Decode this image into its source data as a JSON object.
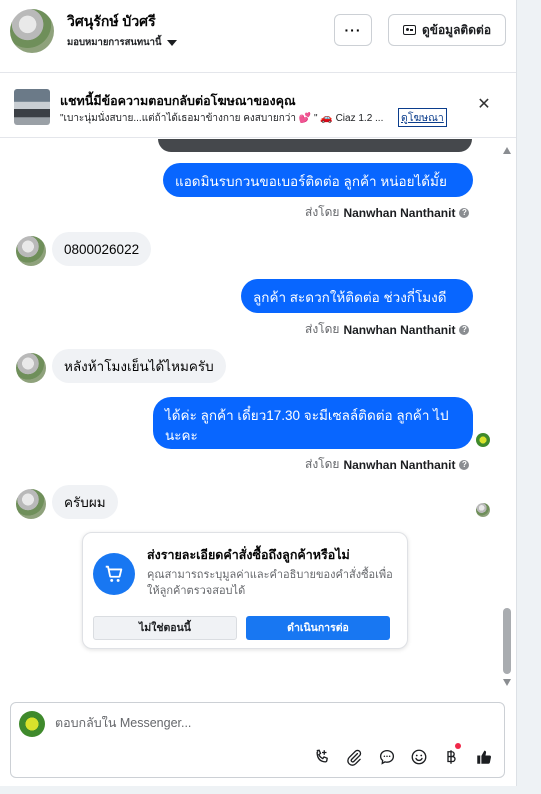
{
  "header": {
    "contact_name": "วิศนุรักษ์ บัวศรี",
    "assign_label": "มอบหมายการสนทนานี้",
    "more_label": "···",
    "contact_info_label": "ดูข้อมูลติดต่อ"
  },
  "ad_banner": {
    "title": "แชทนี้มีข้อความตอบกลับต่อโฆษณาของคุณ",
    "snippet": "\"เบาะนุ่มนั่งสบาย...แต่ถ้าได้เธอมาข้างกาย คงสบายกว่า 💕 \" 🚗 Ciaz 1.2 ...",
    "link_label": "ดูโฆษณา",
    "close_label": "✕"
  },
  "messages": [
    {
      "direction": "out",
      "text": "แอดมินรบกวนขอเบอร์ติดต่อ ลูกค้า หน่อยได้มั้ยคะ",
      "sender_prefix": "ส่งโดย",
      "sender_name": "Nanwhan Nanthanit"
    },
    {
      "direction": "in",
      "text": "0800026022"
    },
    {
      "direction": "out",
      "text": "ลูกค้า สะดวกให้ติดต่อ ช่วงกี่โมงดีคะ",
      "sender_prefix": "ส่งโดย",
      "sender_name": "Nanwhan Nanthanit"
    },
    {
      "direction": "in",
      "text": "หลังห้าโมงเย็นได้ไหมครับ"
    },
    {
      "direction": "out",
      "text": "ได้ค่ะ  ลูกค้า เดี๋ยว17.30 จะมีเซลล์ติดต่อ ลูกค้า ไปนะคะ",
      "sender_prefix": "ส่งโดย",
      "sender_name": "Nanwhan Nanthanit"
    },
    {
      "direction": "in",
      "text": "ครับผม"
    }
  ],
  "order_card": {
    "title": "ส่งรายละเอียดคำสั่งซื้อถึงลูกค้าหรือไม่",
    "description": "คุณสามารถระบุมูลค่าและคำอธิบายของคำสั่งซื้อเพื่อให้ลูกค้าตรวจสอบได้",
    "decline_label": "ไม่ใช่ตอนนี้",
    "continue_label": "ดำเนินการต่อ",
    "icon": "cart-icon"
  },
  "composer": {
    "placeholder": "ตอบกลับใน Messenger...",
    "tools": [
      "call-icon",
      "attachment-icon",
      "saved-reply-icon",
      "emoji-icon",
      "baht-payment-icon",
      "like-icon"
    ]
  },
  "colors": {
    "accent": "#0866ff",
    "incoming_bubble": "#f0f2f5",
    "notification_dot": "#f02849"
  }
}
